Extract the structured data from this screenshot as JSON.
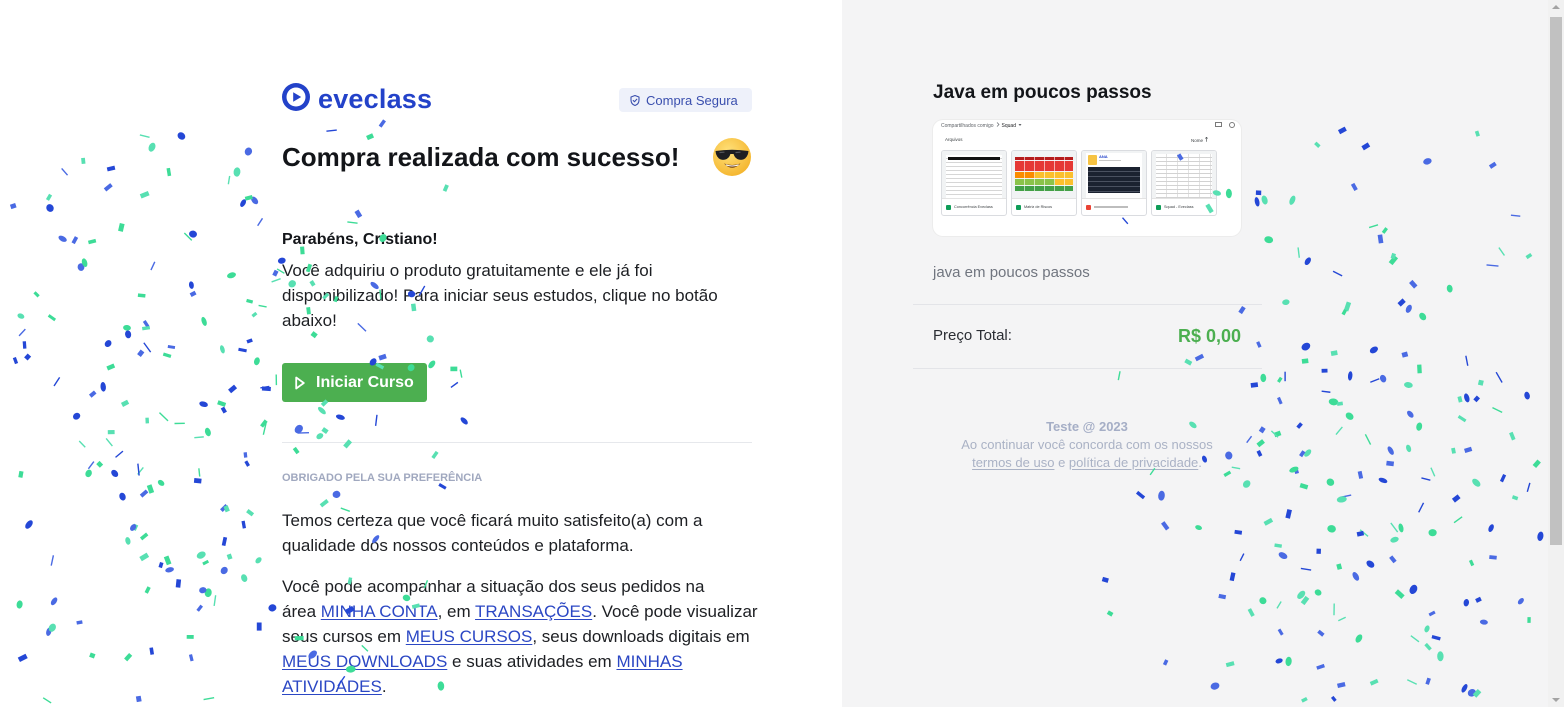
{
  "brand": {
    "name": "eveclass",
    "logo_icon": "play-circle-logo-icon",
    "color": "#2342c9"
  },
  "secure_badge": {
    "label": "Compra Segura",
    "icon": "shield-check-icon"
  },
  "success": {
    "title": "Compra realizada com sucesso!",
    "emoji_icon": "smiling-face-with-sunglasses-icon"
  },
  "greeting": "Parabéns, Cristiano!",
  "intro": {
    "lines": [
      "Você adquiriu o produto gratuitamente e ele já foi",
      "disponibilizado! Para iniciar seus estudos, clique no botão",
      "abaixo!"
    ]
  },
  "start_button": {
    "label": "Iniciar Curso",
    "icon": "play-outline-icon",
    "color": "#4caf50"
  },
  "thanks": {
    "heading": "OBRIGADO PELA SUA PREFERÊNCIA",
    "lines": [
      "Temos certeza que você ficará muito satisfeito(a) com a",
      "qualidade dos nossos conteúdos e plataforma."
    ]
  },
  "orders": {
    "line1": "Você pode acompanhar a situação dos seus pedidos na",
    "area": "área ",
    "em": ", em ",
    "visualizar": ". Você pode visualizar",
    "cursos_em": "seus cursos em ",
    "downloads_em": ", seus downloads digitais em",
    "atividades_em": " e suas atividades em ",
    "end": ".",
    "links": {
      "minha_conta": "MINHA CONTA",
      "transacoes": "TRANSAÇÕES",
      "meus_cursos": "MEUS CURSOS",
      "meus_downloads": "MEUS DOWNLOADS",
      "minhas_atividades": "MINHAS ATIVIDADES"
    },
    "link_color": "#2b47c4"
  },
  "order_summary": {
    "product_title": "Java em poucos passos",
    "thumbnail": {
      "breadcrumb": [
        "Compartilhados comigo",
        "Squad"
      ],
      "section_label": "Arquivos",
      "sort_label": "Nome",
      "files": [
        {
          "name": "Concorrência Eveclass",
          "icon": "google-sheets-icon"
        },
        {
          "name": "Matriz de Riscos",
          "icon": "google-sheets-icon"
        },
        {
          "icon": "pdf-file-icon",
          "preview_label": "ANA"
        },
        {
          "name": "Squad - Eveclass",
          "icon": "google-sheets-icon"
        }
      ]
    },
    "product_description": "java em poucos passos",
    "total_label": "Preço Total:",
    "total_value": "R$ 0,00",
    "total_color": "#4caf50"
  },
  "footer": {
    "copyright": "Teste @ 2023",
    "consent_text": "Ao continuar você concorda com os nossos",
    "terms_link": "termos de uso",
    "and": " e ",
    "privacy_link": "política de privacidade",
    "end": "."
  },
  "confetti": {
    "colors": [
      "#2447d6",
      "#4a6ae3",
      "#3ddc97",
      "#58e0b2"
    ]
  }
}
